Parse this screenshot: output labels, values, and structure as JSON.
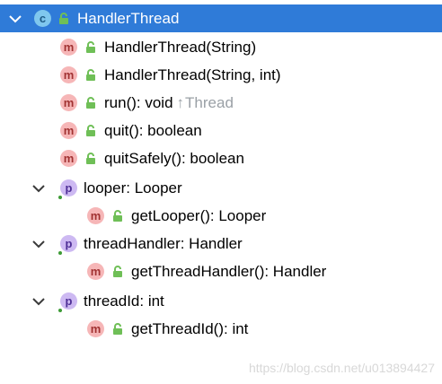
{
  "tree": {
    "root": {
      "icon": "class-icon",
      "badge": "c",
      "label": "HandlerThread"
    },
    "methods": [
      {
        "badge": "m",
        "label": "HandlerThread(String)"
      },
      {
        "badge": "m",
        "label": "HandlerThread(String, int)"
      },
      {
        "badge": "m",
        "label": "run(): void",
        "inherited_arrow": "↑",
        "inherited_from": "Thread"
      },
      {
        "badge": "m",
        "label": "quit(): boolean"
      },
      {
        "badge": "m",
        "label": "quitSafely(): boolean"
      }
    ],
    "properties": [
      {
        "badge": "p",
        "label": "looper: Looper",
        "child": {
          "badge": "m",
          "label": "getLooper(): Looper"
        }
      },
      {
        "badge": "p",
        "label": "threadHandler: Handler",
        "child": {
          "badge": "m",
          "label": "getThreadHandler(): Handler"
        }
      },
      {
        "badge": "p",
        "label": "threadId: int",
        "child": {
          "badge": "m",
          "label": "getThreadId(): int"
        }
      }
    ]
  },
  "watermark": "https://blog.csdn.net/u013894427",
  "colors": {
    "selection": "#2f7bd8",
    "method_badge": "#f6b6b7",
    "property_badge": "#cdb9f2",
    "class_badge": "#7fc7ee",
    "lock": "#6fbf57",
    "inherited_text": "#9aa0a6"
  }
}
